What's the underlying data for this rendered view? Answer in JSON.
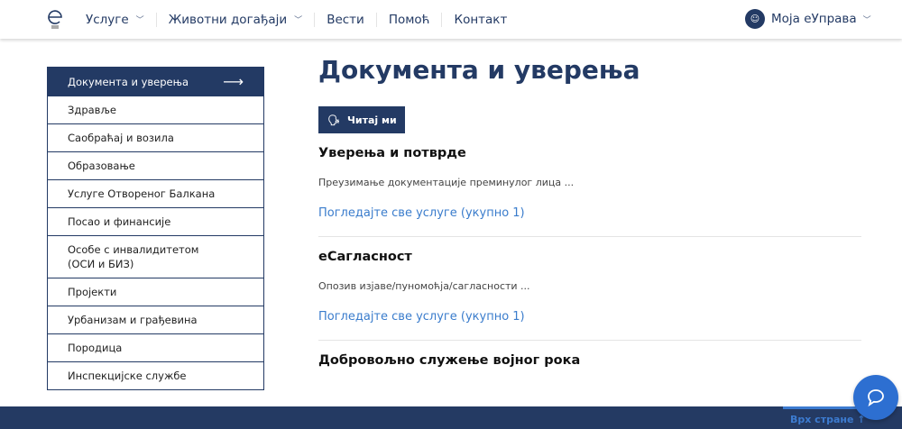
{
  "header": {
    "nav": [
      {
        "label": "Услуге",
        "dropdown": true
      },
      {
        "label": "Животни догађаји",
        "dropdown": true
      },
      {
        "label": "Вести"
      },
      {
        "label": "Помоћ"
      },
      {
        "label": "Контакт"
      }
    ],
    "account_label": "Моја еУправа"
  },
  "sidebar": {
    "items": [
      "Документа и уверења",
      "Здравље",
      "Саобраћај и возила",
      "Образовање",
      "Услуге Отвореног Балкана",
      "Посао и финансије",
      "Особе с инвалидитетом (ОСИ и БИЗ)",
      "Пројекти",
      "Урбанизам и грађевина",
      "Породица",
      "Инспекцијске службе"
    ],
    "active": 0
  },
  "main": {
    "title": "Документа и уверења",
    "read_button": "Читај ми",
    "sections": [
      {
        "title": "Уверења и потврде",
        "desc": "Преузимање документације преминулог лица ...",
        "link": "Погледајте све услуге (укупно 1)"
      },
      {
        "title": "еСагласност",
        "desc": "Опозив изјаве/пуномоћја/сагласности ...",
        "link": "Погледајте све услуге (укупно 1)"
      },
      {
        "title": "Добровољно служење војног рока"
      }
    ]
  },
  "footer": {
    "to_top": "Врх стране ↑"
  },
  "colors": {
    "primary": "#233a64",
    "link": "#3a7ccc",
    "chat": "#2d6fd1"
  }
}
